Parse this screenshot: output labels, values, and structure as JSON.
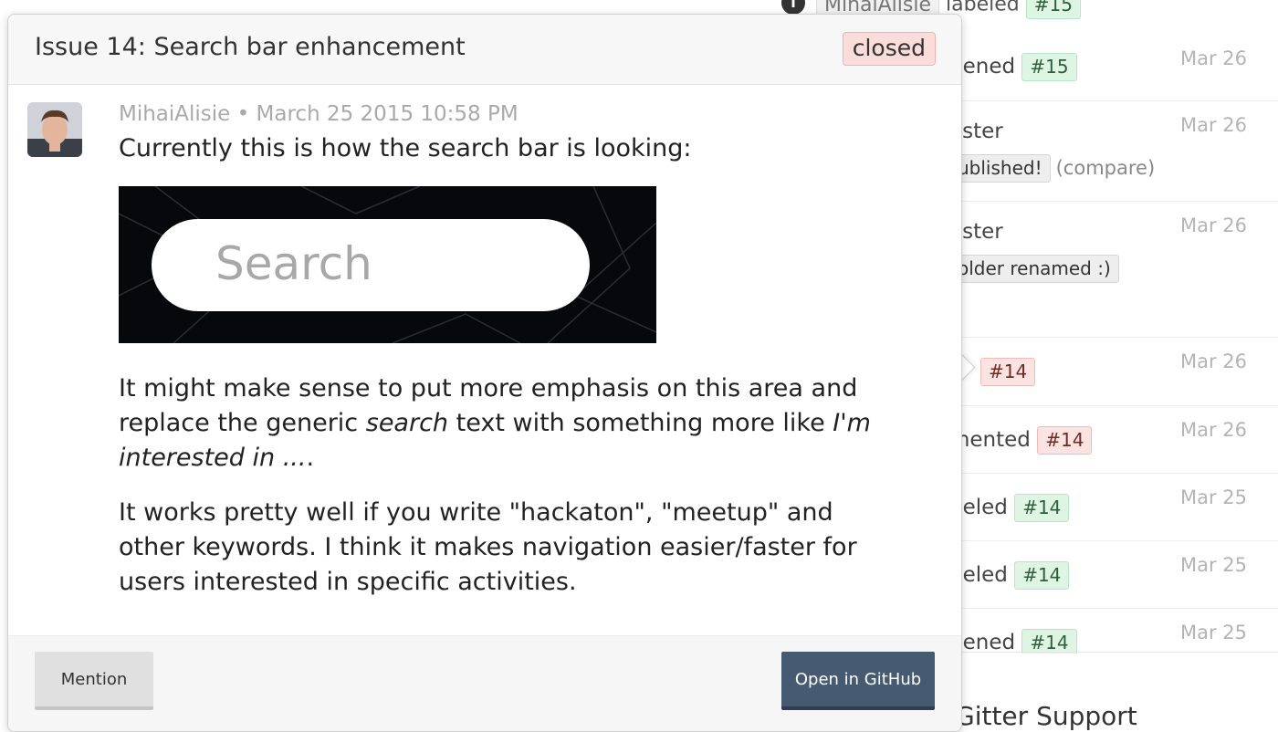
{
  "background_feed": {
    "top_partial": {
      "author": "MihaiAlisie",
      "action": "labeled",
      "tag": "#15"
    },
    "rows": [
      {
        "text": "pened",
        "tag": "#15",
        "tag_color": "green",
        "date": "Mar 26"
      },
      {
        "text": "aster",
        "extra_tag": "ublished!",
        "extra_suffix": "(compare)",
        "date": "Mar 26"
      },
      {
        "text": "aster",
        "extra_tag": "older renamed :)",
        "date": "Mar 26"
      },
      {
        "text": "",
        "tag": "#14",
        "tag_color": "red",
        "date": "Mar 26"
      },
      {
        "text": "mented",
        "tag": "#14",
        "tag_color": "red",
        "date": "Mar 26"
      },
      {
        "text": "beled",
        "tag": "#14",
        "tag_color": "green",
        "date": "Mar 25"
      },
      {
        "text": "beled",
        "tag": "#14",
        "tag_color": "green",
        "date": "Mar 25"
      },
      {
        "text": "pened",
        "tag": "#14",
        "tag_color": "green",
        "date": "Mar 25"
      }
    ],
    "footer_title": "Gitter Support"
  },
  "popup": {
    "title": "Issue 14: Search bar enhancement",
    "state": "closed",
    "author": "MihaiAlisie",
    "separator": "•",
    "timestamp": "March 25 2015 10:58 PM",
    "para_1": "Currently this is how the search bar is looking:",
    "image_text": "Search",
    "para_2": {
      "before": "It might make sense to put more emphasis on this area and replace the generic ",
      "em_1": "search",
      "middle": " text with something more like ",
      "em_2": "I'm interested in ...",
      "after": "."
    },
    "para_3": "It works pretty well if you write \"hackaton\", \"meetup\" and other keywords. I think it makes navigation easier/faster for users interested in specific activities.",
    "buttons": {
      "mention": "Mention",
      "open": "Open in GitHub"
    }
  },
  "colors": {
    "closed_badge": "#fadcda",
    "primary_button": "#465a71",
    "tag_green": "#dff5e4",
    "tag_red": "#fbe3e1"
  }
}
